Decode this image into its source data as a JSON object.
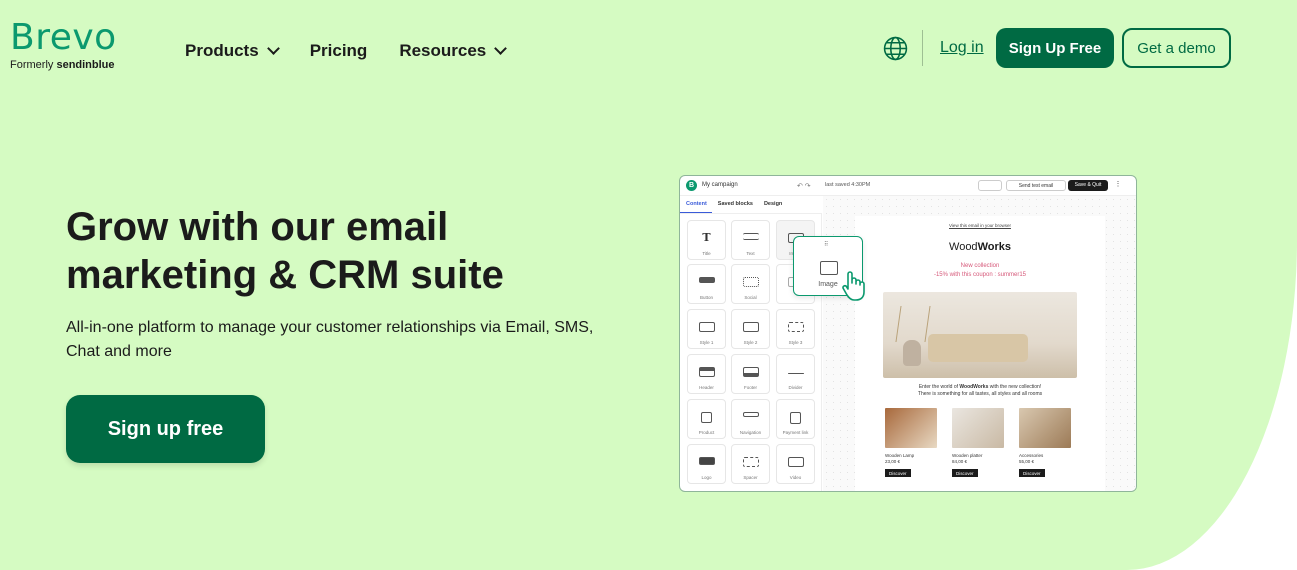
{
  "header": {
    "logo_text": "Brevo",
    "logo_formerly": "Formerly",
    "logo_formerly_brand": "sendinblue",
    "nav": [
      {
        "label": "Products",
        "has_dropdown": true
      },
      {
        "label": "Pricing",
        "has_dropdown": false
      },
      {
        "label": "Resources",
        "has_dropdown": true
      }
    ],
    "language_icon": "globe-icon",
    "login_label": "Log in",
    "signup_label": "Sign Up Free",
    "demo_label": "Get a demo"
  },
  "hero": {
    "headline_line1": "Grow with our email",
    "headline_line2": "marketing & CRM suite",
    "subtext": "All-in-one platform to manage your customer relationships via Email, SMS, Chat and more",
    "cta_label": "Sign up free"
  },
  "mockup": {
    "logo_letter": "B",
    "campaign_name": "My campaign",
    "last_saved": "last saved 4:30PM",
    "send_test_label": "Send test email",
    "save_quit_label": "Save & Quit",
    "tabs": [
      "Content",
      "Saved blocks",
      "Design"
    ],
    "blocks": [
      "Title",
      "Text",
      "Image",
      "Button",
      "Social",
      "",
      "Style 1",
      "Style 2",
      "Style 3",
      "Header",
      "Footer",
      "Divider",
      "Product",
      "Navigation",
      "Payment link",
      "Logo",
      "Spacer",
      "Video"
    ],
    "drag_label": "Image",
    "email": {
      "view_in_browser": "View this email in your browser",
      "brand_light": "Wood",
      "brand_bold": "Works",
      "new_collection": "New collection",
      "coupon": "-15% with this coupon : summer15",
      "intro_pre": "Enter the world of",
      "intro_brand": "WoodWorks",
      "intro_post": "with the new collection!",
      "intro_line2": "There is something for all tastes, all styles and all rooms",
      "products": [
        {
          "name": "Wooden Lamp",
          "price": "23,00 €",
          "cta": "Discover"
        },
        {
          "name": "Wooden platter",
          "price": "84,00 €",
          "cta": "Discover"
        },
        {
          "name": "Accessories",
          "price": "55,00 €",
          "cta": "Discover"
        }
      ]
    }
  },
  "colors": {
    "background": "#d5fbc2",
    "brand_green": "#006a43",
    "logo_green": "#0b996e",
    "accent_pink": "#d6597a"
  }
}
